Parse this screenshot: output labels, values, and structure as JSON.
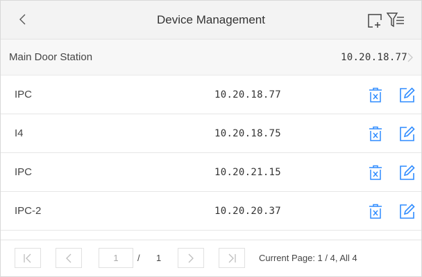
{
  "header": {
    "title": "Device Management",
    "back_icon": "back-chevron-icon",
    "add_icon": "add-device-icon",
    "filter_icon": "filter-icon"
  },
  "main_station": {
    "name": "Main Door Station",
    "ip": "10.20.18.77"
  },
  "devices": [
    {
      "name": "IPC",
      "ip": "10.20.18.77"
    },
    {
      "name": "I4",
      "ip": "10.20.18.75"
    },
    {
      "name": "IPC",
      "ip": "10.20.21.15"
    },
    {
      "name": "IPC-2",
      "ip": "10.20.20.37"
    }
  ],
  "pager": {
    "page_input": "1",
    "separator": "/",
    "total_pages": "1",
    "status": "Current Page: 1 / 4, All 4"
  },
  "colors": {
    "accent": "#2f8cff",
    "muted": "#bdbdbd",
    "text": "#333333"
  }
}
